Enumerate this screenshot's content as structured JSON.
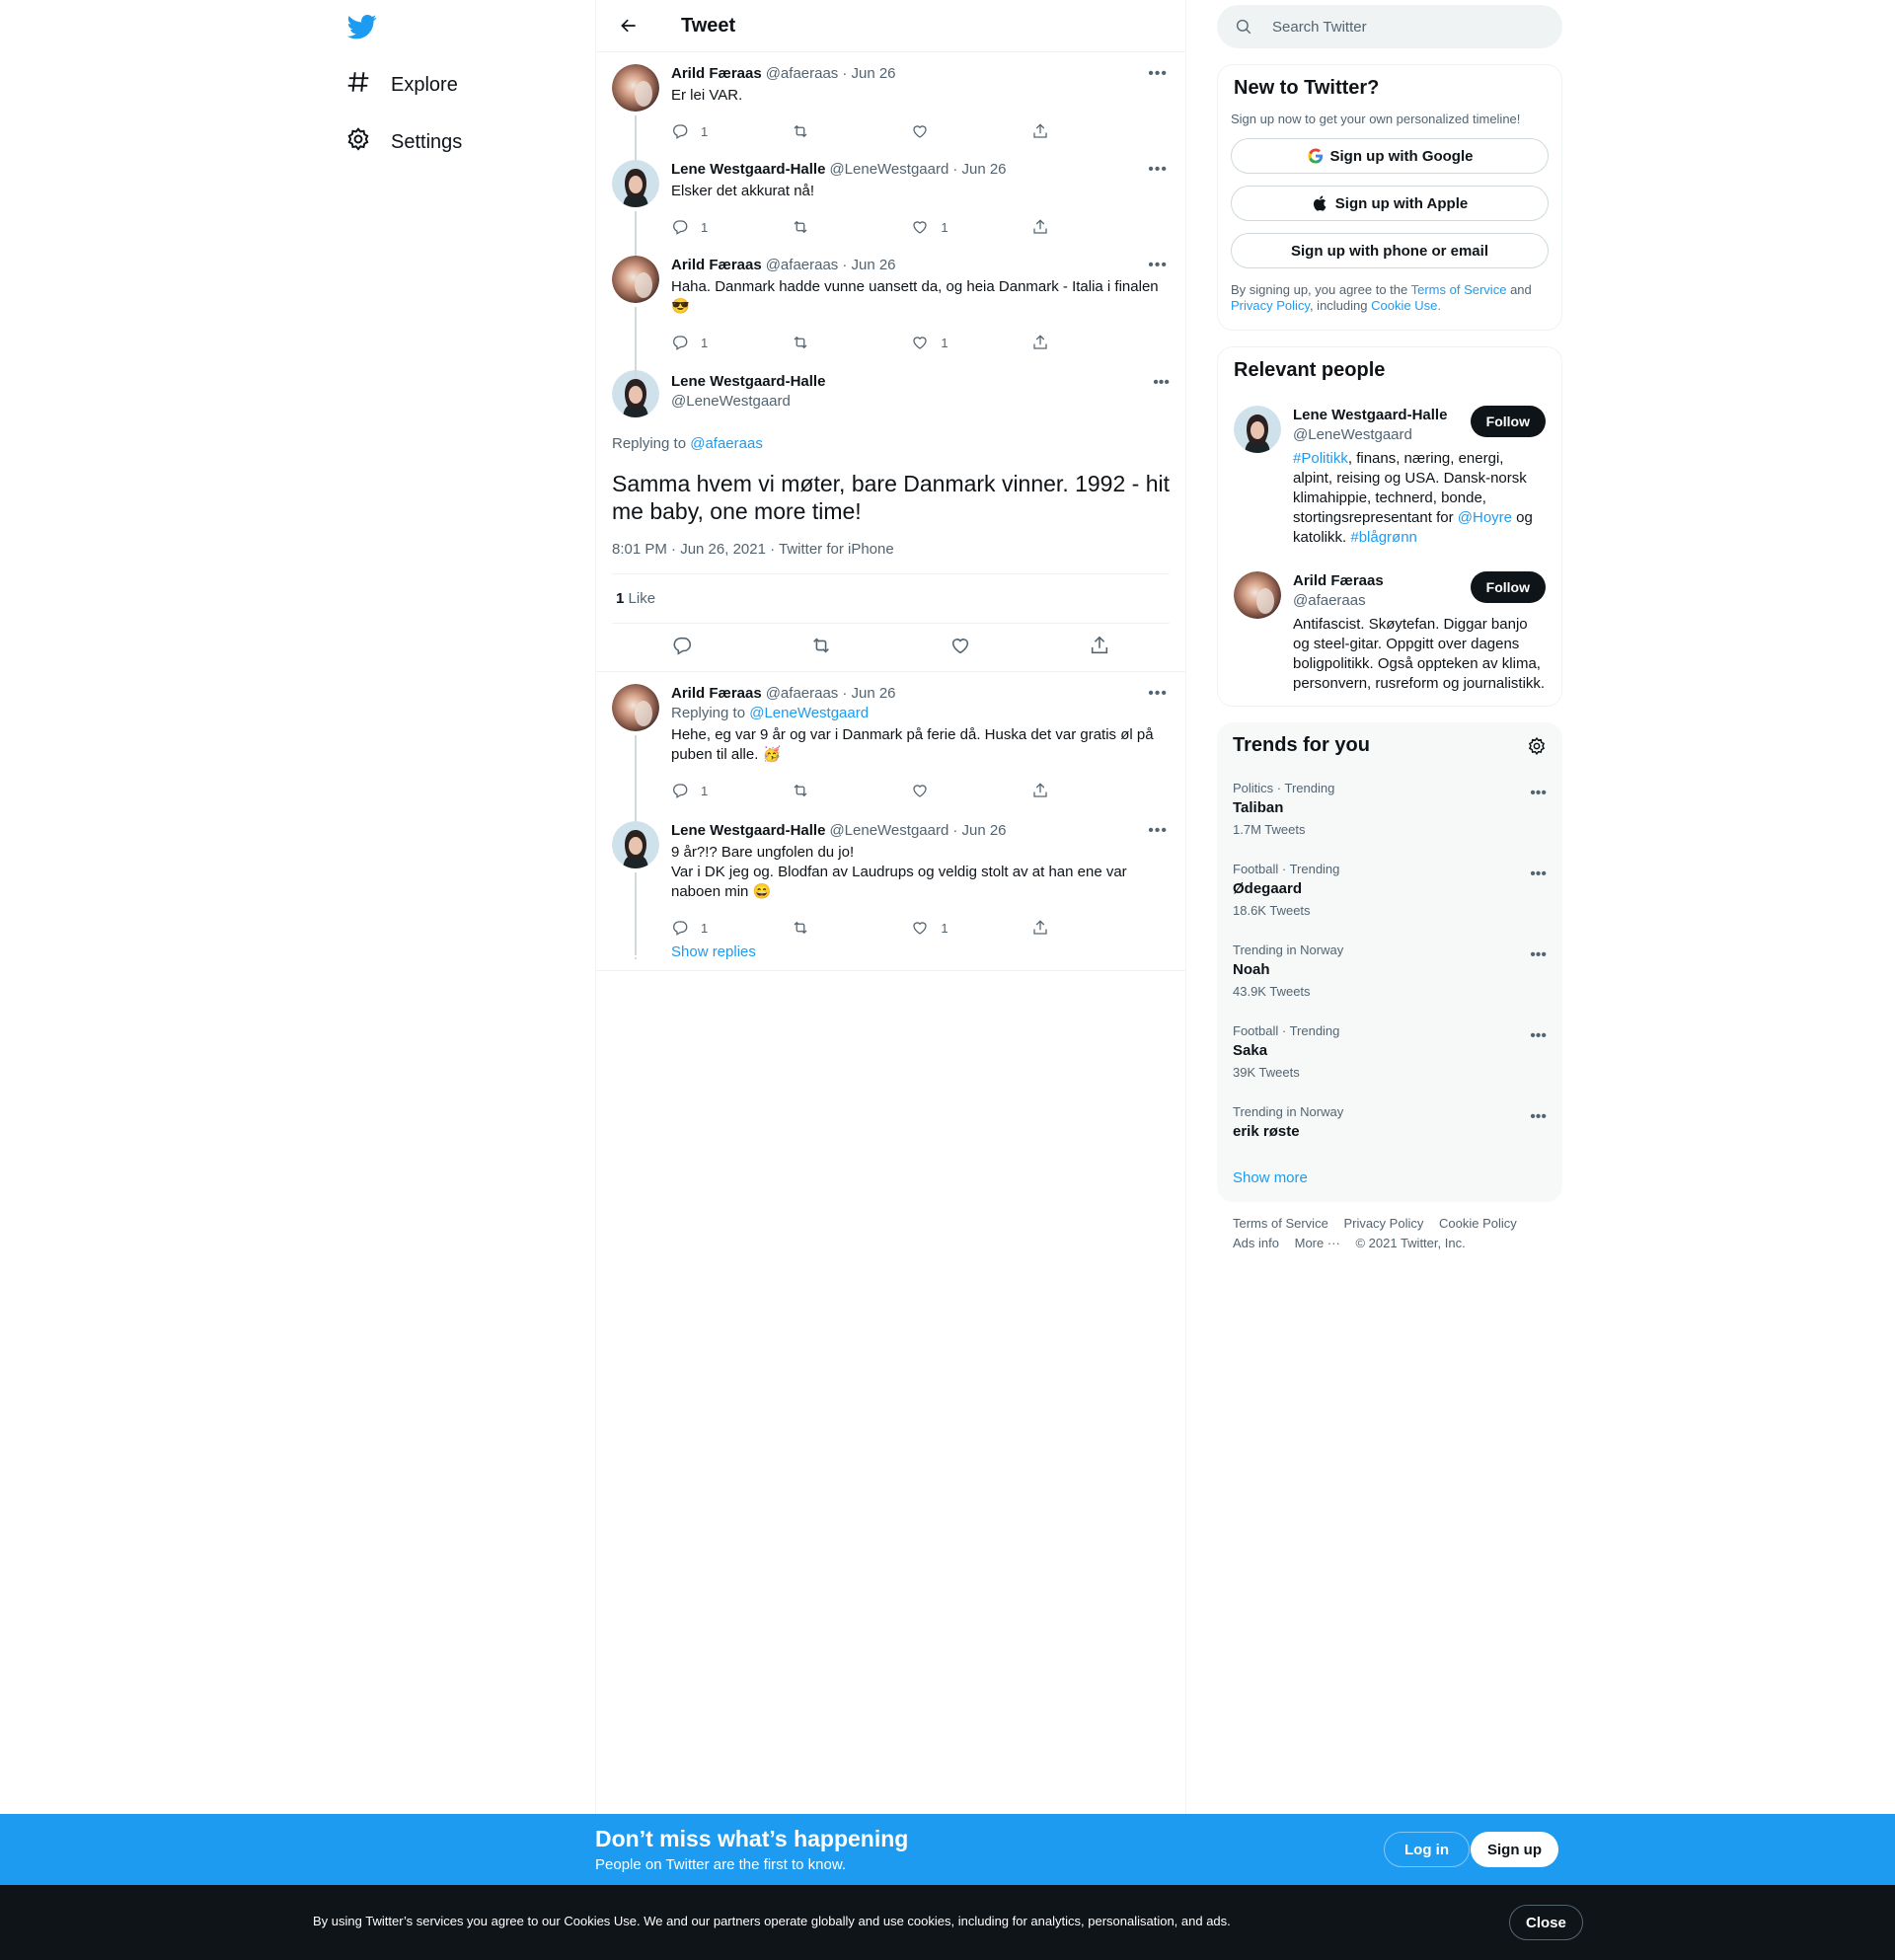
{
  "nav": {
    "logo": "twitter-logo",
    "items": [
      {
        "label": "Explore",
        "icon": "hashtag-icon"
      },
      {
        "label": "Settings",
        "icon": "gear-icon"
      }
    ]
  },
  "header": {
    "title": "Tweet"
  },
  "thread_before": [
    {
      "name": "Arild Færaas",
      "handle": "@afaeraas",
      "date": "· Jun 26",
      "text": "Er lei VAR.",
      "replies": "1",
      "likes": "",
      "avatar": "arild"
    },
    {
      "name": "Lene Westgaard-Halle",
      "handle": "@LeneWestgaard",
      "date": "· Jun 26",
      "text": "Elsker det akkurat nå!",
      "replies": "1",
      "likes": "1",
      "avatar": "lene"
    },
    {
      "name": "Arild Færaas",
      "handle": "@afaeraas",
      "date": "· Jun 26",
      "text": "Haha. Danmark hadde vunne uansett da, og heia Danmark - Italia i finalen\n😎",
      "replies": "1",
      "likes": "1",
      "avatar": "arild"
    }
  ],
  "focal": {
    "name": "Lene Westgaard-Halle",
    "handle": "@LeneWestgaard",
    "replying_prefix": "Replying to",
    "replying_to": "@afaeraas",
    "text": "Samma hvem vi møter, bare Danmark vinner. 1992 - hit me baby, one more time!",
    "meta": "8:01 PM · Jun 26, 2021 · Twitter for iPhone",
    "like_count": "1",
    "like_label": "Like"
  },
  "replies": [
    {
      "name": "Arild Færaas",
      "handle": "@afaeraas",
      "date": "· Jun 26",
      "replying_prefix": "Replying to",
      "replying_to": "@LeneWestgaard",
      "text": "Hehe, eg var 9 år og var i Danmark på ferie då. Huska det var gratis øl på\npuben til alle. 🥳",
      "replies": "1",
      "likes": "",
      "avatar": "arild"
    },
    {
      "name": "Lene Westgaard-Halle",
      "handle": "@LeneWestgaard",
      "date": "· Jun 26",
      "replying_prefix": "",
      "replying_to": "",
      "text": "9 år?!? Bare ungfolen du jo!\nVar i DK jeg og. Blodfan av Laudrups og veldig stolt av at han ene var\nnaboen min 😄",
      "replies": "1",
      "likes": "1",
      "avatar": "lene"
    }
  ],
  "show_replies": "Show replies",
  "search": {
    "placeholder": "Search Twitter"
  },
  "new_to_twitter": {
    "title": "New to Twitter?",
    "subtitle": "Sign up now to get your own personalized timeline!",
    "google": "Sign up with Google",
    "apple": "Sign up with Apple",
    "phone": "Sign up with phone or email",
    "terms_prefix": "By signing up, you agree to the",
    "terms_link": "Terms of Service",
    "and": "and",
    "privacy_link": "Privacy Policy",
    "including": ", including",
    "cookie_link": "Cookie Use."
  },
  "relevant": {
    "title": "Relevant people",
    "people": [
      {
        "name": "Lene Westgaard-Halle",
        "handle": "@LeneWestgaard",
        "follow": "Follow",
        "avatar": "lene"
      },
      {
        "name": "Arild Færaas",
        "handle": "@afaeraas",
        "follow": "Follow",
        "avatar": "arild"
      }
    ],
    "bio_lene": {
      "hashtag1": "#Politikk",
      "text1": ", finans, næring, energi, alpint, reising og USA. Dansk-norsk klimahippie, technerd, bonde, stortingsrepresentant for ",
      "mention": "@Hoyre",
      "text2": " og katolikk. ",
      "hashtag2": "#blågrønn"
    },
    "bio_arild": "Antifascist. Skøytefan. Diggar banjo og steel-gitar. Oppgitt over dagens boligpolitikk. Også oppteken av klima, personvern, rusreform og journalistikk."
  },
  "trends": {
    "title": "Trends for you",
    "items": [
      {
        "meta": "Politics · Trending",
        "name": "Taliban",
        "count": "1.7M Tweets"
      },
      {
        "meta": "Football · Trending",
        "name": "Ødegaard",
        "count": "18.6K Tweets"
      },
      {
        "meta": "Trending in Norway",
        "name": "Noah",
        "count": "43.9K Tweets"
      },
      {
        "meta": "Football · Trending",
        "name": "Saka",
        "count": "39K Tweets"
      },
      {
        "meta": "Trending in Norway",
        "name": "erik røste",
        "count": ""
      }
    ],
    "show_more": "Show more"
  },
  "footer": {
    "terms": "Terms of Service",
    "privacy": "Privacy Policy",
    "cookie": "Cookie Policy",
    "ads": "Ads info",
    "more": "More ···",
    "copyright": "© 2021 Twitter, Inc."
  },
  "bottom_bar": {
    "title": "Don’t miss what’s happening",
    "subtitle": "People on Twitter are the first to know.",
    "login": "Log in",
    "signup": "Sign up"
  },
  "cookie_bar": {
    "text": "By using Twitter’s services you agree to our Cookies Use. We and our partners operate globally and use cookies, including for analytics, personalisation, and ads.",
    "close": "Close"
  },
  "colors": {
    "accent": "#1d9bf0",
    "text": "#0f1419",
    "muted": "#536471",
    "dark_bar": "#0f1419"
  }
}
